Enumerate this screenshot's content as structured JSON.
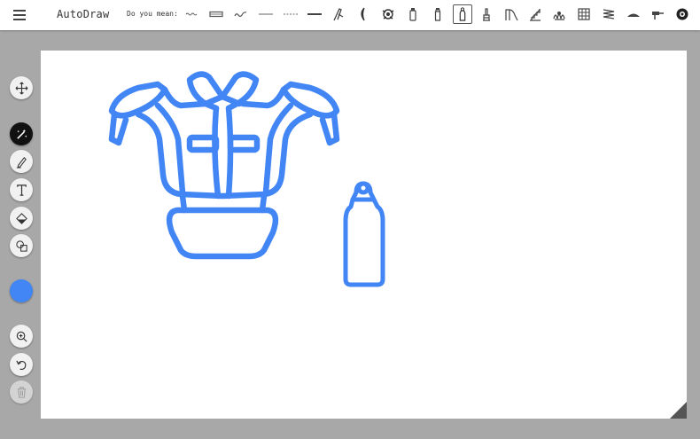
{
  "app": {
    "title": "AutoDraw"
  },
  "suggestions": {
    "label": "Do you mean:",
    "items": [
      {
        "name": "wavy-line"
      },
      {
        "name": "double-line"
      },
      {
        "name": "squiggle"
      },
      {
        "name": "thin-line"
      },
      {
        "name": "dashed-line"
      },
      {
        "name": "thick-line"
      },
      {
        "name": "quill"
      },
      {
        "name": "crescent"
      },
      {
        "name": "ornament"
      },
      {
        "name": "small-bottle"
      },
      {
        "name": "slim-bottle"
      },
      {
        "name": "water-bottle",
        "selected": true
      },
      {
        "name": "tower"
      },
      {
        "name": "slide"
      },
      {
        "name": "stairs"
      },
      {
        "name": "grass-cluster"
      },
      {
        "name": "pattern"
      },
      {
        "name": "scribble-block"
      },
      {
        "name": "mountain"
      },
      {
        "name": "drill"
      },
      {
        "name": "wheel"
      }
    ]
  },
  "tools": [
    {
      "name": "move-tool",
      "icon": "move-icon"
    },
    {
      "name": "autodraw-tool",
      "icon": "autodraw-icon",
      "active": true
    },
    {
      "name": "draw-tool",
      "icon": "pencil-icon"
    },
    {
      "name": "type-tool",
      "icon": "text-icon"
    },
    {
      "name": "fill-tool",
      "icon": "fill-bucket-icon"
    },
    {
      "name": "shape-tool",
      "icon": "shapes-icon"
    },
    {
      "name": "zoom-tool",
      "icon": "zoom-in-icon"
    },
    {
      "name": "undo-tool",
      "icon": "undo-icon"
    },
    {
      "name": "delete-tool",
      "icon": "trash-icon",
      "disabled": true
    }
  ],
  "colors": {
    "current": "#4285f4",
    "stroke": "#4285f4"
  },
  "canvas": {
    "drawings": [
      {
        "name": "shoulder-pads-drawing"
      },
      {
        "name": "water-bottle-drawing"
      }
    ]
  }
}
